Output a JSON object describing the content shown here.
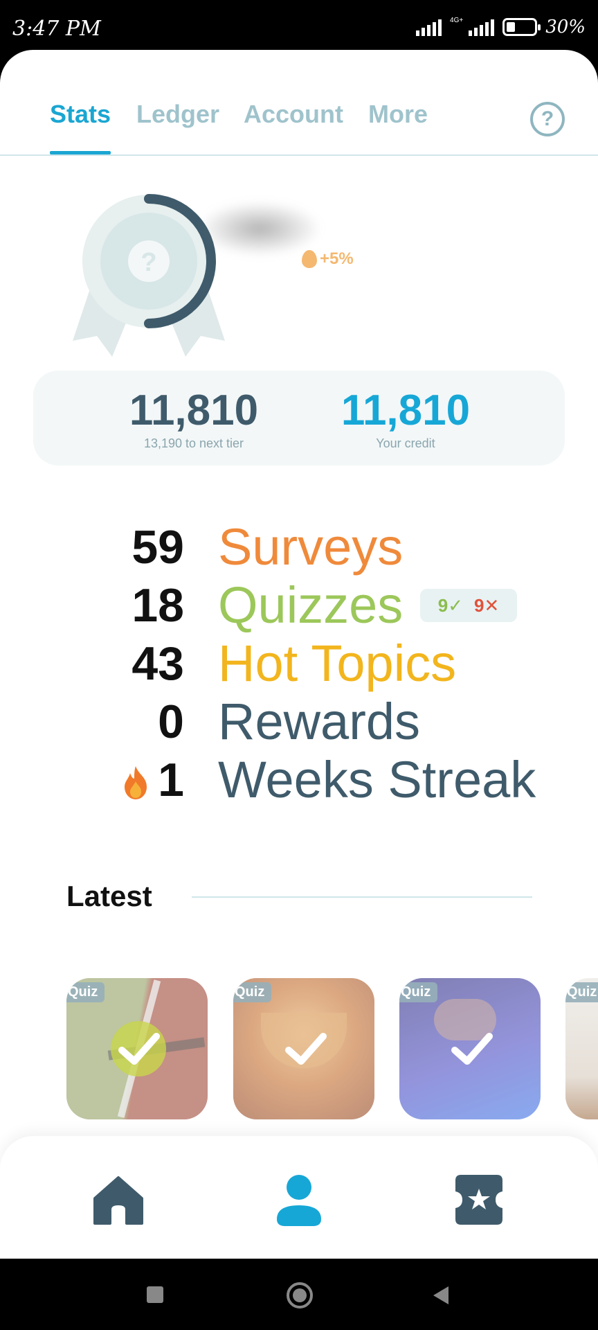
{
  "status_bar": {
    "time": "3:47 PM",
    "network": "4G+",
    "battery": "30%"
  },
  "tabs": [
    {
      "label": "Stats",
      "active": true
    },
    {
      "label": "Ledger",
      "active": false
    },
    {
      "label": "Account",
      "active": false
    },
    {
      "label": "More",
      "active": false
    }
  ],
  "help_icon": "help-circle-icon",
  "badge": {
    "icon": "award-ribbon-icon",
    "bonus": "+5%"
  },
  "points": {
    "tier_value": "11,810",
    "tier_label": "13,190 to next tier",
    "credit_value": "11,810",
    "credit_label": "Your credit"
  },
  "counts": [
    {
      "number": "59",
      "label": "Surveys",
      "color": "#ef8a3b"
    },
    {
      "number": "18",
      "label": "Quizzes",
      "color": "#9cc75a"
    },
    {
      "number": "43",
      "label": "Hot Topics",
      "color": "#f2b51d"
    },
    {
      "number": "0",
      "label": "Rewards",
      "color": "#3f5b6b"
    },
    {
      "number": "1",
      "label": "Weeks Streak",
      "color": "#3f5b6b"
    }
  ],
  "quiz_score": {
    "correct": "9✓",
    "wrong": "9✕",
    "correct_color": "#8bbd4d",
    "wrong_color": "#e0533a"
  },
  "latest": {
    "title": "Latest",
    "cards": [
      {
        "tag": "Quiz",
        "image": "tennis-ball-court"
      },
      {
        "tag": "Quiz",
        "image": "tea-cup"
      },
      {
        "tag": "Quiz",
        "image": "hand-dark-blue"
      },
      {
        "tag": "Quiz",
        "image": "room-partial"
      }
    ]
  },
  "bottom_nav": [
    {
      "icon": "home-icon",
      "active": false
    },
    {
      "icon": "profile-icon",
      "active": true
    },
    {
      "icon": "rewards-ticket-icon",
      "active": false
    }
  ],
  "colors": {
    "accent": "#1aa6d2",
    "dark": "#3f5b6b",
    "muted": "#9fc3cc"
  }
}
